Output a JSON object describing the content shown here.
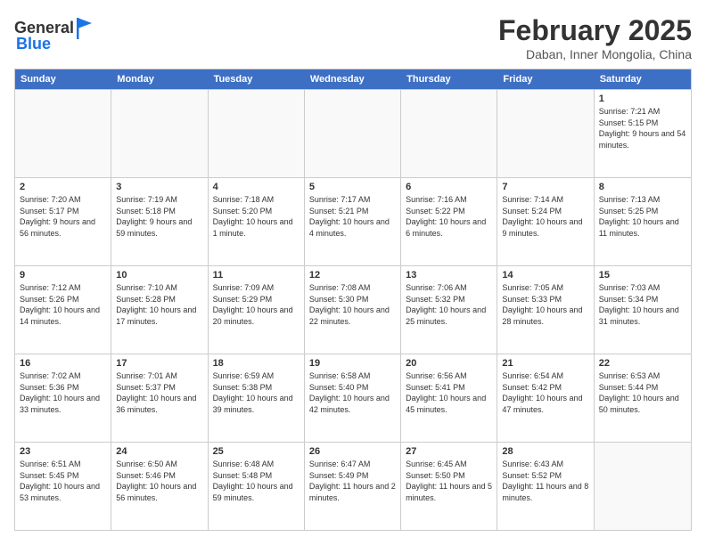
{
  "header": {
    "logo_general": "General",
    "logo_blue": "Blue",
    "title": "February 2025",
    "subtitle": "Daban, Inner Mongolia, China"
  },
  "days_of_week": [
    "Sunday",
    "Monday",
    "Tuesday",
    "Wednesday",
    "Thursday",
    "Friday",
    "Saturday"
  ],
  "weeks": [
    [
      {
        "day": "",
        "text": ""
      },
      {
        "day": "",
        "text": ""
      },
      {
        "day": "",
        "text": ""
      },
      {
        "day": "",
        "text": ""
      },
      {
        "day": "",
        "text": ""
      },
      {
        "day": "",
        "text": ""
      },
      {
        "day": "1",
        "text": "Sunrise: 7:21 AM\nSunset: 5:15 PM\nDaylight: 9 hours and 54 minutes."
      }
    ],
    [
      {
        "day": "2",
        "text": "Sunrise: 7:20 AM\nSunset: 5:17 PM\nDaylight: 9 hours and 56 minutes."
      },
      {
        "day": "3",
        "text": "Sunrise: 7:19 AM\nSunset: 5:18 PM\nDaylight: 9 hours and 59 minutes."
      },
      {
        "day": "4",
        "text": "Sunrise: 7:18 AM\nSunset: 5:20 PM\nDaylight: 10 hours and 1 minute."
      },
      {
        "day": "5",
        "text": "Sunrise: 7:17 AM\nSunset: 5:21 PM\nDaylight: 10 hours and 4 minutes."
      },
      {
        "day": "6",
        "text": "Sunrise: 7:16 AM\nSunset: 5:22 PM\nDaylight: 10 hours and 6 minutes."
      },
      {
        "day": "7",
        "text": "Sunrise: 7:14 AM\nSunset: 5:24 PM\nDaylight: 10 hours and 9 minutes."
      },
      {
        "day": "8",
        "text": "Sunrise: 7:13 AM\nSunset: 5:25 PM\nDaylight: 10 hours and 11 minutes."
      }
    ],
    [
      {
        "day": "9",
        "text": "Sunrise: 7:12 AM\nSunset: 5:26 PM\nDaylight: 10 hours and 14 minutes."
      },
      {
        "day": "10",
        "text": "Sunrise: 7:10 AM\nSunset: 5:28 PM\nDaylight: 10 hours and 17 minutes."
      },
      {
        "day": "11",
        "text": "Sunrise: 7:09 AM\nSunset: 5:29 PM\nDaylight: 10 hours and 20 minutes."
      },
      {
        "day": "12",
        "text": "Sunrise: 7:08 AM\nSunset: 5:30 PM\nDaylight: 10 hours and 22 minutes."
      },
      {
        "day": "13",
        "text": "Sunrise: 7:06 AM\nSunset: 5:32 PM\nDaylight: 10 hours and 25 minutes."
      },
      {
        "day": "14",
        "text": "Sunrise: 7:05 AM\nSunset: 5:33 PM\nDaylight: 10 hours and 28 minutes."
      },
      {
        "day": "15",
        "text": "Sunrise: 7:03 AM\nSunset: 5:34 PM\nDaylight: 10 hours and 31 minutes."
      }
    ],
    [
      {
        "day": "16",
        "text": "Sunrise: 7:02 AM\nSunset: 5:36 PM\nDaylight: 10 hours and 33 minutes."
      },
      {
        "day": "17",
        "text": "Sunrise: 7:01 AM\nSunset: 5:37 PM\nDaylight: 10 hours and 36 minutes."
      },
      {
        "day": "18",
        "text": "Sunrise: 6:59 AM\nSunset: 5:38 PM\nDaylight: 10 hours and 39 minutes."
      },
      {
        "day": "19",
        "text": "Sunrise: 6:58 AM\nSunset: 5:40 PM\nDaylight: 10 hours and 42 minutes."
      },
      {
        "day": "20",
        "text": "Sunrise: 6:56 AM\nSunset: 5:41 PM\nDaylight: 10 hours and 45 minutes."
      },
      {
        "day": "21",
        "text": "Sunrise: 6:54 AM\nSunset: 5:42 PM\nDaylight: 10 hours and 47 minutes."
      },
      {
        "day": "22",
        "text": "Sunrise: 6:53 AM\nSunset: 5:44 PM\nDaylight: 10 hours and 50 minutes."
      }
    ],
    [
      {
        "day": "23",
        "text": "Sunrise: 6:51 AM\nSunset: 5:45 PM\nDaylight: 10 hours and 53 minutes."
      },
      {
        "day": "24",
        "text": "Sunrise: 6:50 AM\nSunset: 5:46 PM\nDaylight: 10 hours and 56 minutes."
      },
      {
        "day": "25",
        "text": "Sunrise: 6:48 AM\nSunset: 5:48 PM\nDaylight: 10 hours and 59 minutes."
      },
      {
        "day": "26",
        "text": "Sunrise: 6:47 AM\nSunset: 5:49 PM\nDaylight: 11 hours and 2 minutes."
      },
      {
        "day": "27",
        "text": "Sunrise: 6:45 AM\nSunset: 5:50 PM\nDaylight: 11 hours and 5 minutes."
      },
      {
        "day": "28",
        "text": "Sunrise: 6:43 AM\nSunset: 5:52 PM\nDaylight: 11 hours and 8 minutes."
      },
      {
        "day": "",
        "text": ""
      }
    ]
  ]
}
